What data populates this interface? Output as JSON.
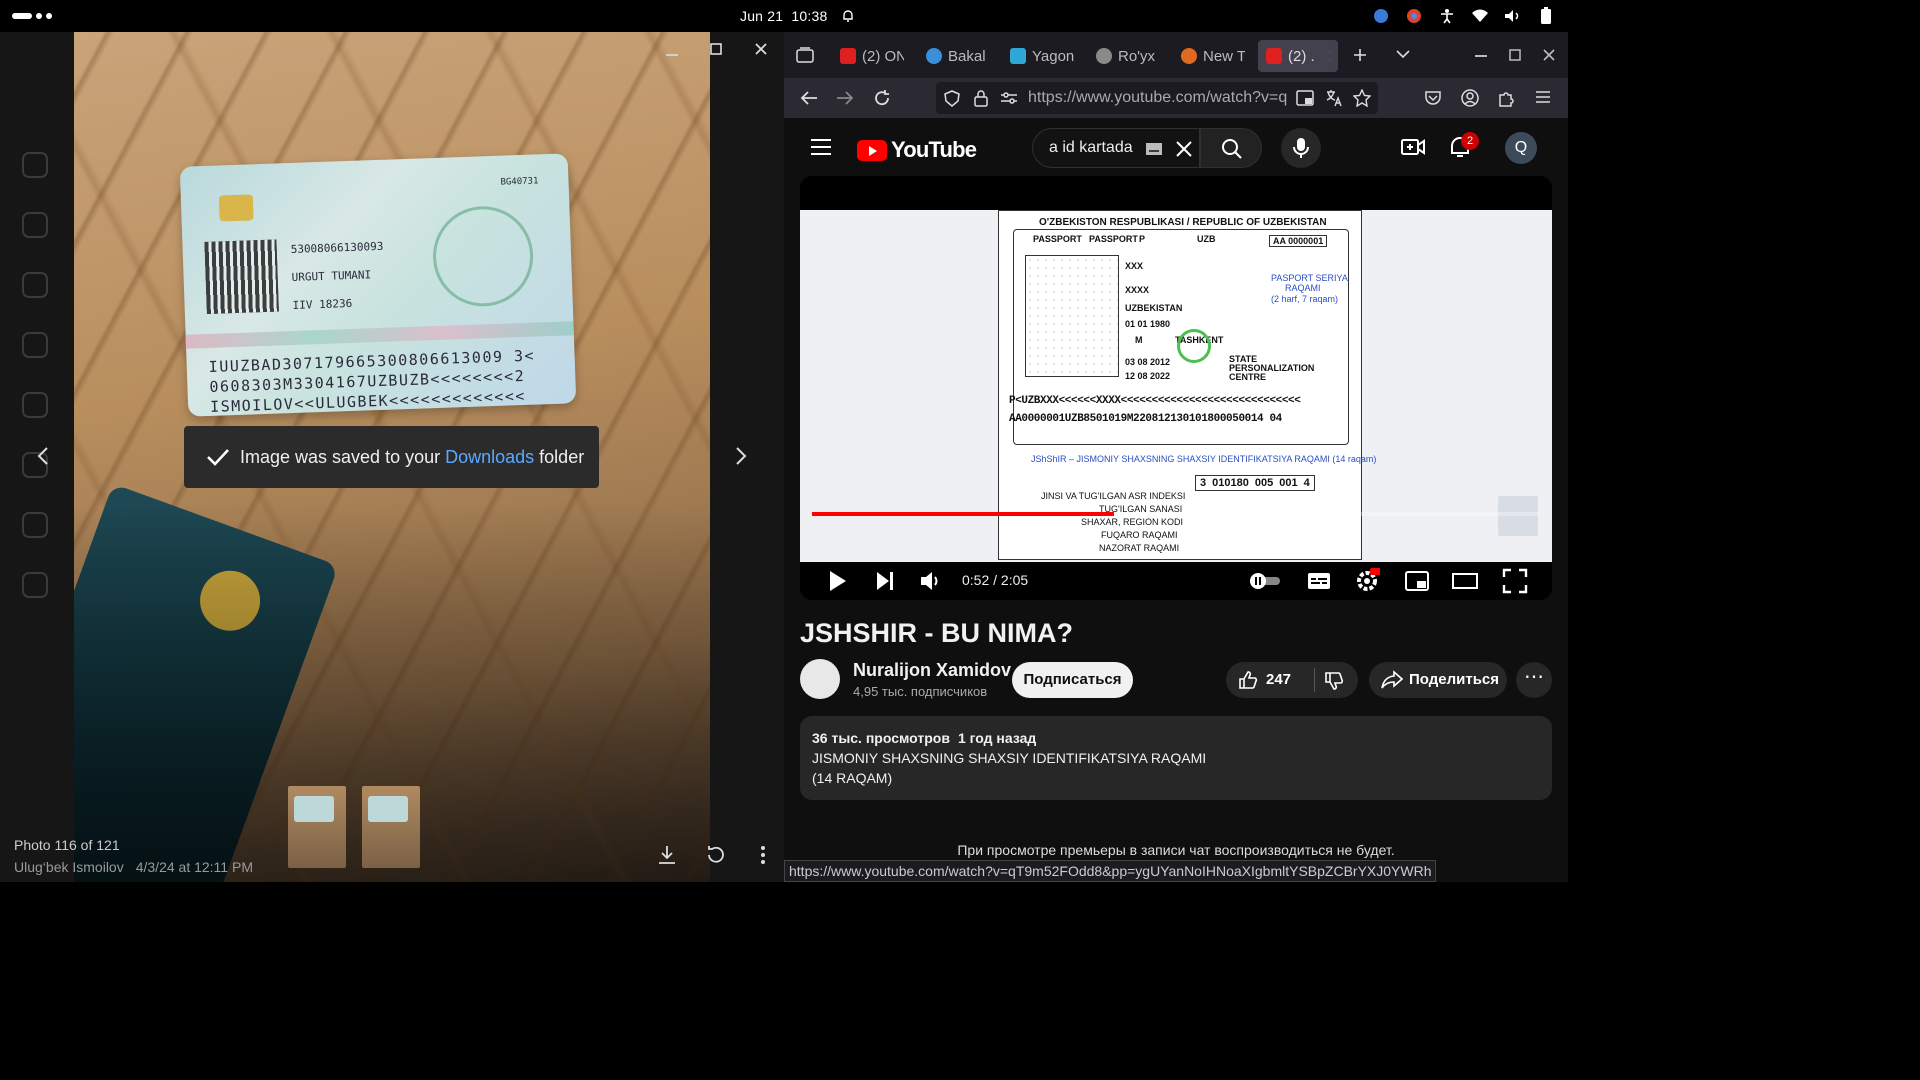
{
  "topbar": {
    "date": "Jun 21",
    "time": "10:38"
  },
  "viewer": {
    "toast": {
      "prefix": "Image was saved to your",
      "link": "Downloads",
      "suffix": "folder"
    },
    "counter": "Photo 116 of 121",
    "author": "Ulug‘bek Ismoilov",
    "timestamp": "4/3/24 at 12:11 PM",
    "card": {
      "serial": "BG40731",
      "personal_number": "53008066130093",
      "place": "URGUT TUMANI",
      "issue": "IIV 18236",
      "mrz1": "IUUZBAD307179665300806613009 3<",
      "mrz2": "0608303M3304167UZBUZB<<<<<<<<2",
      "mrz3": "ISMOILOV<<ULUGBEK<<<<<<<<<<<<<"
    }
  },
  "browser": {
    "tabs": [
      {
        "label": "(2) ON",
        "color": "#e02020"
      },
      {
        "label": "Bakal",
        "color": "#3a8fd8"
      },
      {
        "label": "Yagon",
        "color": "#2fa8d8"
      },
      {
        "label": "Ro'yx",
        "color": "#8a8a8a"
      },
      {
        "label": "New T",
        "color": "#e06a20"
      },
      {
        "label": "(2) .",
        "color": "#e02020"
      }
    ],
    "url": "https://www.youtube.com/watch?v=q",
    "status_url": "https://www.youtube.com/watch?v=qT9m52FOdd8&pp=ygUYanNoIHNoaXIgbmltYSBpZCBrYXJ0YWRh"
  },
  "youtube": {
    "logo": "YouTube",
    "search_value": "a id kartada",
    "notifications": "2",
    "account_initial": "Q",
    "time": "0:52 / 2:05",
    "progress": 0.415,
    "title": "JSHSHIR - BU NIMA?",
    "channel": "Nuralijon Xamidov",
    "subscribers": "4,95 тыс. подписчиков",
    "subscribe": "Подписаться",
    "likes": "247",
    "share": "Поделиться",
    "views": "36 тыс. просмотров",
    "age": "1 год назад",
    "desc1": "JISMONIY SHAXSNING SHAXSIY IDENTIFIKATSIYA RAQAMI",
    "desc2": "(14 RAQAM)",
    "premiere": "При просмотре премьеры в записи чат воспроизводиться не будет."
  },
  "video": {
    "header": "O'ZBEKISTON RESPUBLIKASI / REPUBLIC OF UZBEKISTAN",
    "passport": "PASSPORT",
    "type": "P",
    "country": "UZB",
    "number": "AA 0000001",
    "surname": "XXX",
    "given": "XXXX",
    "nationality": "UZBEKISTAN",
    "dob": "01   01   1980",
    "sex": "M",
    "pob": "TASHKENT",
    "issue_date": "03   08   2012",
    "expiry": "12   08   2022",
    "authority": "STATE PERSONALIZATION CENTRE",
    "seriya_1": "PASPORT SERIYA",
    "seriya_2": "RAQAMI",
    "seriya_3": "(2 harf, 7 raqam)",
    "mrz1": "P<UZBXXX<<<<<<XXXX<<<<<<<<<<<<<<<<<<<<<<<<<<<<<",
    "mrz2": "AA0000001UZB8501019M220812130101800050014 04",
    "jshshir": "JShShIR – JISMONIY SHAXSNING SHAXSIY IDENTIFIKATSIYA RAQAMI (14 raqam)",
    "digits": [
      "3",
      "010180",
      "005",
      "001",
      "4"
    ],
    "legend": [
      "JINSI VA TUG'ILGAN ASR INDEKSI",
      "TUG'ILGAN SANASI",
      "SHAXAR, REGION KODI",
      "FUQARO RAQAMI",
      "NAZORAT RAQAMI"
    ]
  }
}
